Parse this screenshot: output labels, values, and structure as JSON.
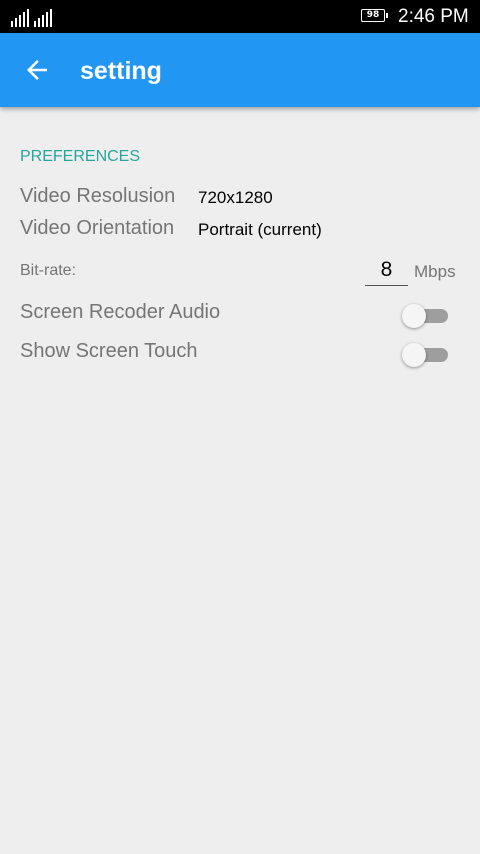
{
  "status_bar": {
    "battery_level": "98",
    "time": "2:46 PM",
    "signal_icon": "signal-bars-icon"
  },
  "app_bar": {
    "title": "setting",
    "back_icon": "arrow-back-icon",
    "color": "#2196f3"
  },
  "preferences": {
    "header": "PREFERENCES",
    "header_color": "#26a69a",
    "video_resolution": {
      "label": "Video Resolusion",
      "value": "720x1280"
    },
    "video_orientation": {
      "label": "Video Orientation",
      "value": "Portrait (current)"
    },
    "bitrate": {
      "label": "Bit-rate:",
      "value": "8",
      "unit": "Mbps"
    },
    "screen_recorder_audio": {
      "label": "Screen Recoder Audio",
      "enabled": false
    },
    "show_screen_touch": {
      "label": "Show Screen Touch",
      "enabled": false
    }
  }
}
